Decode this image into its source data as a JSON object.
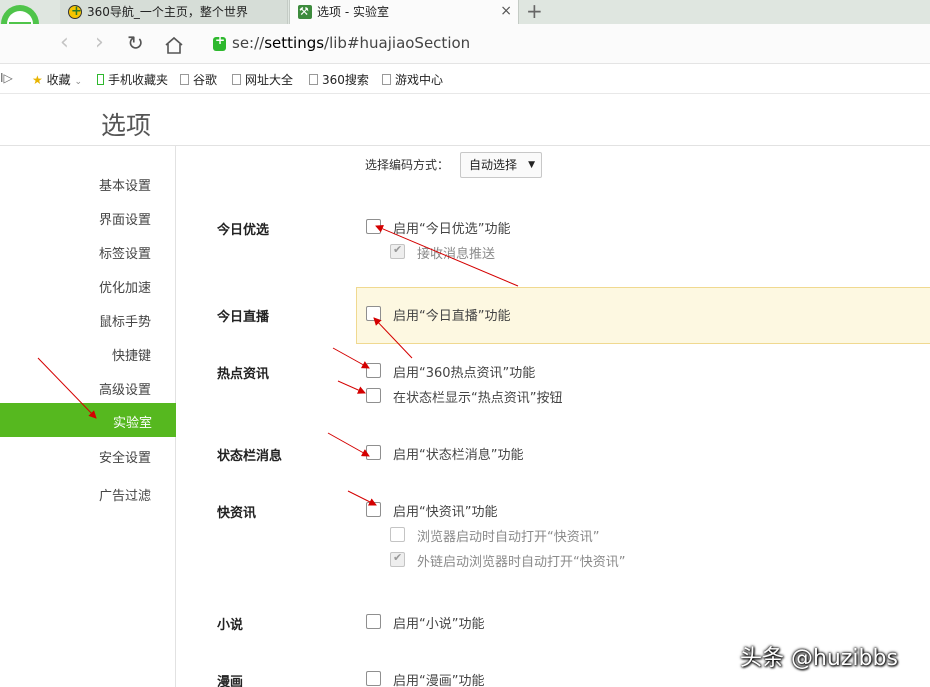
{
  "browser": {
    "tabs": [
      {
        "title": "360导航_一个主页，整个世界",
        "close": "×"
      },
      {
        "title": "选项 - 实验室",
        "close": "×"
      }
    ],
    "new_tab": "+",
    "url_prefix": "se://",
    "url_host": "settings",
    "url_path": "/lib#huajiaoSection",
    "bookmarks": [
      {
        "label": "收藏",
        "icon": "star-icon"
      },
      {
        "label": "手机收藏夹",
        "icon": "phone-icon"
      },
      {
        "label": "谷歌",
        "icon": "page-icon"
      },
      {
        "label": "网址大全",
        "icon": "page-icon"
      },
      {
        "label": "360搜索",
        "icon": "page-icon"
      },
      {
        "label": "游戏中心",
        "icon": "page-icon"
      }
    ],
    "accent_color": "#56b81f"
  },
  "page": {
    "title": "选项",
    "sidebar": [
      "基本设置",
      "界面设置",
      "标签设置",
      "优化加速",
      "鼠标手势",
      "快捷键",
      "高级设置",
      "实验室",
      "安全设置",
      "广告过滤"
    ],
    "active_item": "实验室",
    "encoding_label": "选择编码方式：",
    "encoding_value": "自动选择",
    "sections": [
      {
        "label": "今日优选",
        "options": [
          {
            "text": "启用“今日优选”功能",
            "checked": false
          },
          {
            "text": "接收消息推送",
            "checked": true,
            "sub": true
          }
        ]
      },
      {
        "label": "今日直播",
        "options": [
          {
            "text": "启用“今日直播”功能",
            "checked": false
          }
        ]
      },
      {
        "label": "热点资讯",
        "options": [
          {
            "text": "启用“360热点资讯”功能",
            "checked": false
          },
          {
            "text": "在状态栏显示“热点资讯”按钮",
            "checked": false
          }
        ]
      },
      {
        "label": "状态栏消息",
        "options": [
          {
            "text": "启用“状态栏消息”功能",
            "checked": false
          }
        ]
      },
      {
        "label": "快资讯",
        "options": [
          {
            "text": "启用“快资讯”功能",
            "checked": false
          },
          {
            "text": "浏览器启动时自动打开“快资讯”",
            "checked": false,
            "sub": true
          },
          {
            "text": "外链启动浏览器时自动打开“快资讯”",
            "checked": true,
            "sub": true
          }
        ]
      },
      {
        "label": "小说",
        "options": [
          {
            "text": "启用“小说”功能",
            "checked": false
          }
        ]
      },
      {
        "label": "漫画",
        "options": [
          {
            "text": "启用“漫画”功能",
            "checked": false
          }
        ]
      }
    ]
  },
  "watermark": "头条 @huzibbs"
}
